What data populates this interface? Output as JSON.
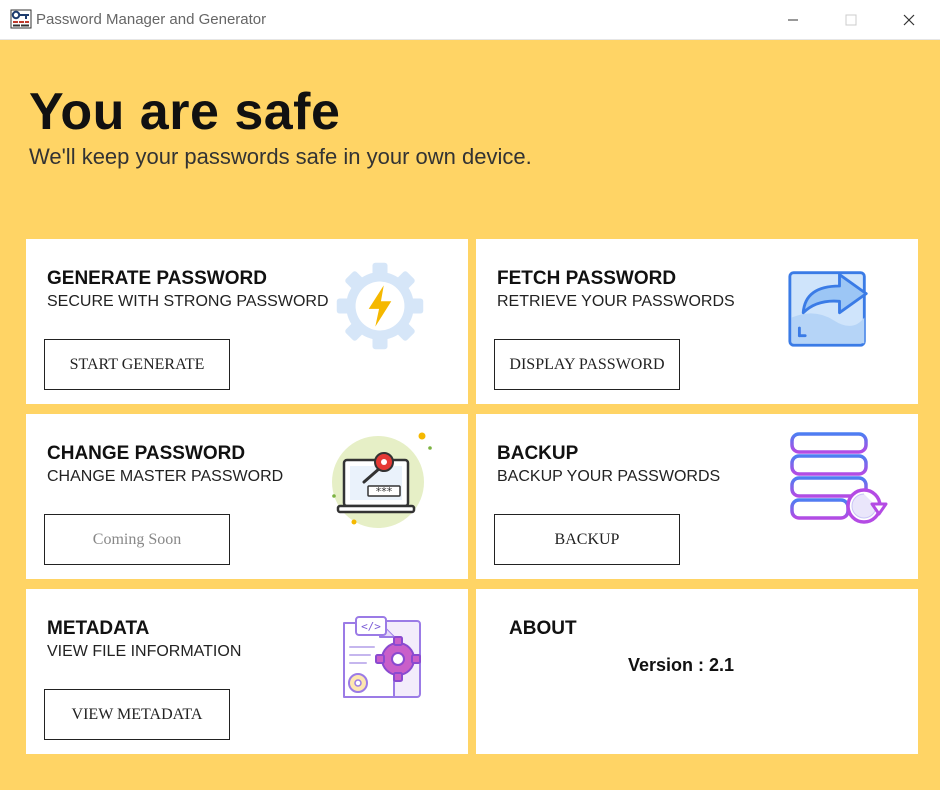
{
  "window": {
    "title": "Password Manager and Generator",
    "minimize_glyph": "—",
    "maximize_glyph": "☐",
    "close_glyph": "✕"
  },
  "hero": {
    "title": "You are safe",
    "subtitle": "We'll keep your passwords safe in your own device."
  },
  "cards": {
    "generate": {
      "title": "GENERATE PASSWORD",
      "subtitle": "SECURE WITH STRONG PASSWORD",
      "button": "START GENERATE",
      "icon": "gear-lightning-icon"
    },
    "fetch": {
      "title": "FETCH PASSWORD",
      "subtitle": "RETRIEVE YOUR PASSWORDS",
      "button": "DISPLAY PASSWORD",
      "icon": "share-arrow-icon"
    },
    "change": {
      "title": "CHANGE PASSWORD",
      "subtitle": "CHANGE MASTER PASSWORD",
      "button": "Coming Soon",
      "icon": "laptop-key-icon"
    },
    "backup": {
      "title": "BACKUP",
      "subtitle": "BACKUP YOUR PASSWORDS",
      "button": "BACKUP",
      "icon": "server-restore-icon"
    },
    "metadata": {
      "title": "METADATA",
      "subtitle": "VIEW FILE INFORMATION",
      "button": "VIEW METADATA",
      "icon": "file-settings-icon"
    },
    "about": {
      "title": "ABOUT",
      "version": "Version : 2.1"
    }
  },
  "colors": {
    "background": "#ffd465",
    "card": "#ffffff",
    "text": "#111111"
  }
}
